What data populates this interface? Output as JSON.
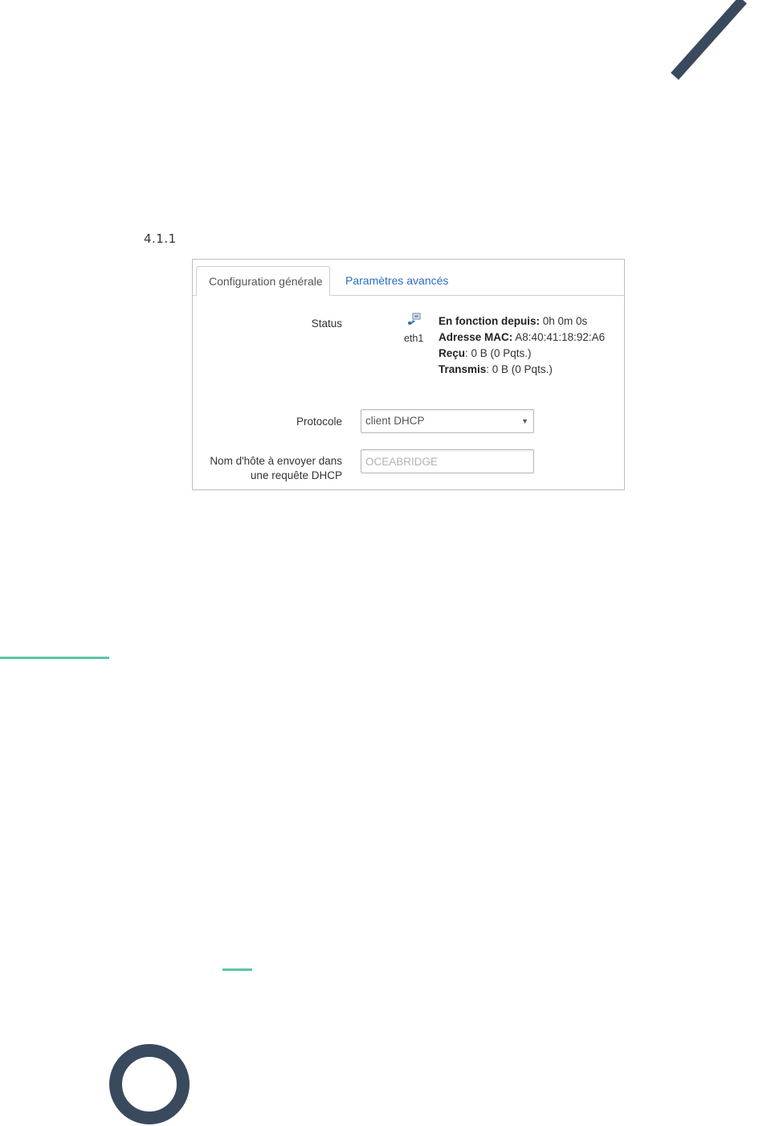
{
  "section": {
    "number": "4.1.1"
  },
  "tabs": [
    {
      "label": "Configuration générale",
      "active": true
    },
    {
      "label": "Paramètres avancés",
      "active": false
    }
  ],
  "status": {
    "label": "Status",
    "interface_icon": "network-interface-icon",
    "interface": "eth1",
    "uptime_label": "En fonction depuis:",
    "uptime_value": "0h 0m 0s",
    "mac_label": "Adresse MAC:",
    "mac_value": "A8:40:41:18:92:A6",
    "received_label": "Reçu",
    "received_value": ": 0 B (0 Pqts.)",
    "transmitted_label": "Transmis",
    "transmitted_value": ": 0 B (0 Pqts.)"
  },
  "protocol": {
    "label": "Protocole",
    "selected": "client DHCP"
  },
  "hostname": {
    "label_line1": "Nom d'hôte à envoyer dans",
    "label_line2": "une requête DHCP",
    "placeholder": "OCEABRIDGE",
    "value": ""
  },
  "colors": {
    "decor_navy": "#3a4a5e",
    "accent_teal": "#5bc4a8",
    "link_blue": "#2b6cc4"
  }
}
